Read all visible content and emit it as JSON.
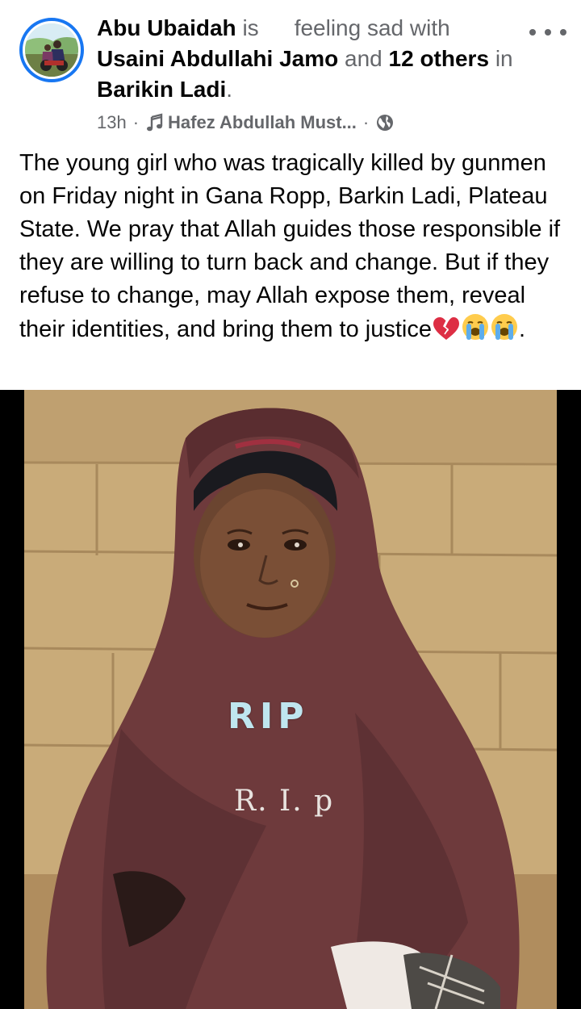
{
  "post": {
    "author": "Abu Ubaidah",
    "is_word": "is",
    "feeling": "feeling sad with",
    "tagged_primary": "Usaini Abdullahi Jamo",
    "and_word": "and",
    "tagged_others": "12 others",
    "in_word": "in",
    "location": "Barikin Ladi",
    "period": ".",
    "time": "13h",
    "separator": "·",
    "music_title": "Hafez Abdullah Must...",
    "privacy_icon": "globe-icon",
    "more_icon": "more-options-icon",
    "caption_text": "The young girl who was tragically killed by gunmen on Friday night in Gana Ropp, Barkin Ladi, Plateau State. We pray that Allah guides those responsible if they are willing to turn back and change. But if they refuse to change, may Allah expose them, reveal their identities, and bring them to justice",
    "caption_end": ".",
    "caption_emojis": [
      "broken-heart-icon",
      "loudly-crying-face-icon",
      "loudly-crying-face-icon"
    ],
    "photo": {
      "overlay_text_1": "RIP",
      "overlay_text_2": "R. I. p"
    }
  },
  "colors": {
    "accent": "#1877f2",
    "text": "#050505",
    "secondary_text": "#65676b"
  }
}
